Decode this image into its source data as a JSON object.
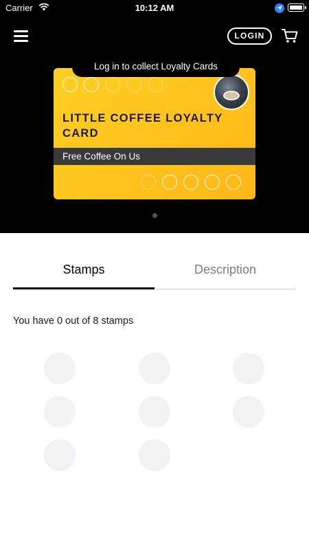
{
  "status_bar": {
    "carrier": "Carrier",
    "time": "10:12 AM"
  },
  "header": {
    "login_label": "LOGIN"
  },
  "card": {
    "banner": "Log in to collect Loyalty Cards",
    "title": "LITTLE COFFEE LOYALTY CARD",
    "reward": "Free Coffee On Us",
    "accent_color": "#ffc21e",
    "page_count": 1
  },
  "tabs": [
    {
      "label": "Stamps",
      "selected": true
    },
    {
      "label": "Description",
      "selected": false
    }
  ],
  "stamps": {
    "summary": "You have 0 out of 8 stamps",
    "collected": 0,
    "total": 8
  },
  "icons": [
    "wifi-icon",
    "location-arrow-icon",
    "battery-icon",
    "menu-icon",
    "cart-icon",
    "coffee-cup-icon"
  ]
}
